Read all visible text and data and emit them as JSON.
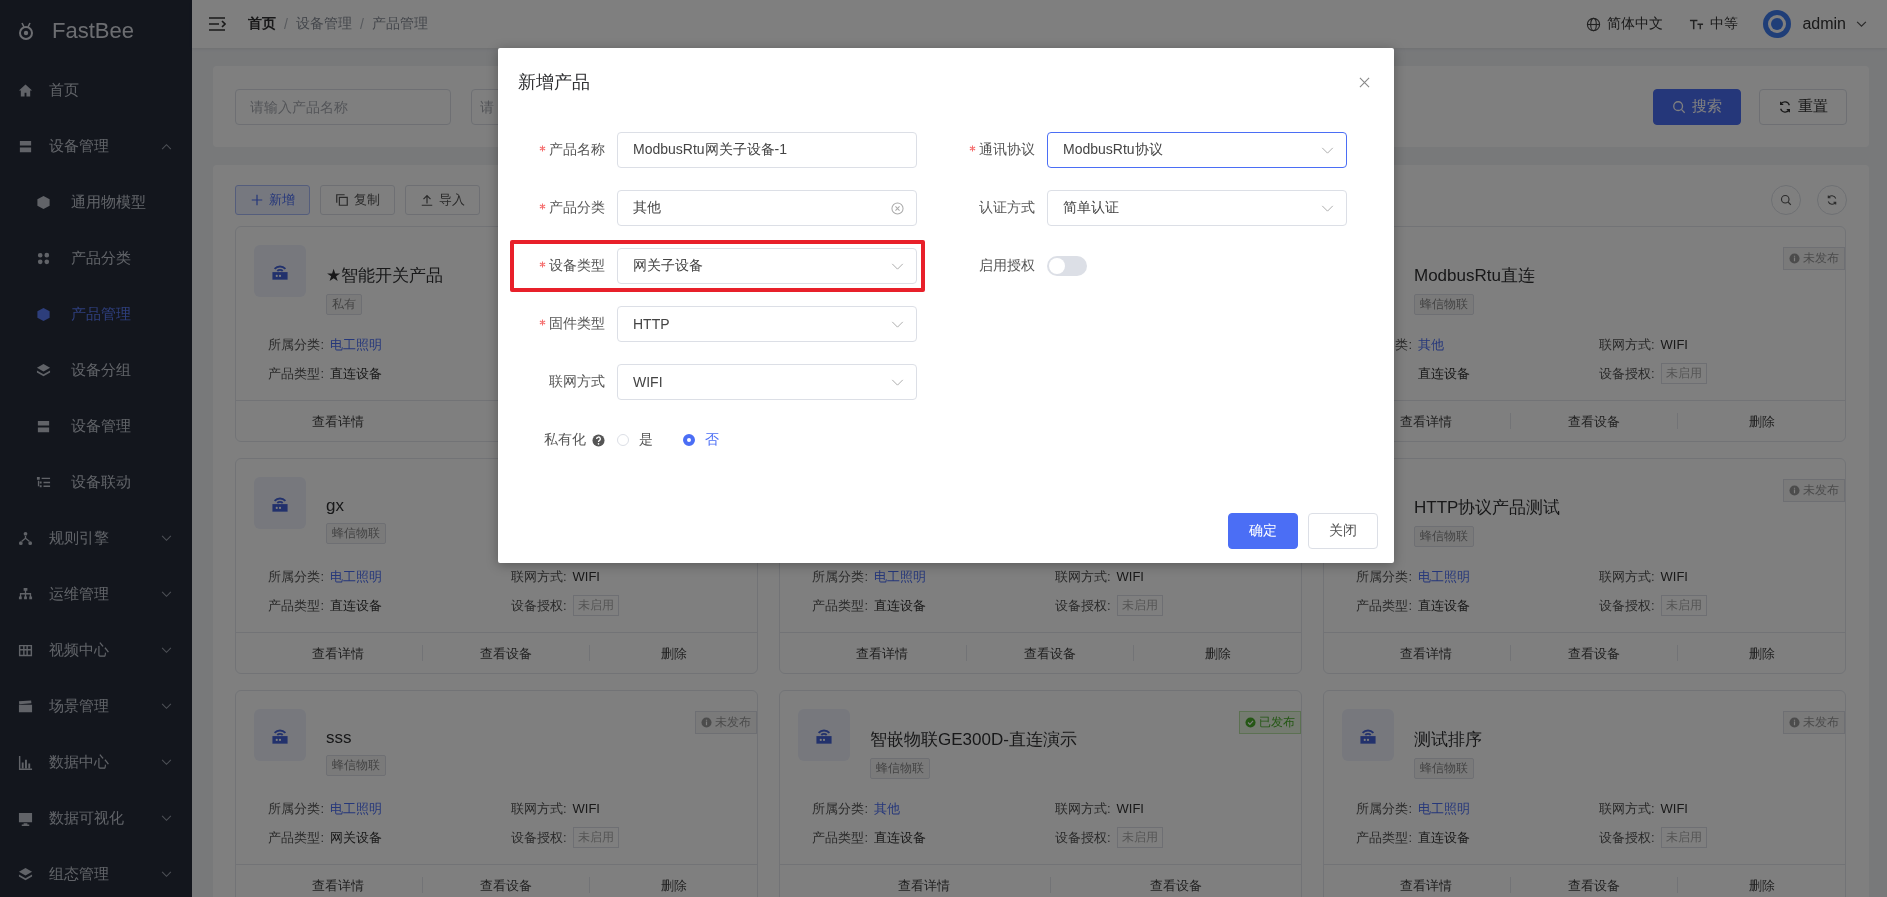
{
  "sidebar": {
    "logo": "FastBee",
    "items": [
      {
        "label": "首页",
        "kind": "link",
        "selected": false
      },
      {
        "label": "设备管理",
        "kind": "group",
        "expanded": true,
        "selected": false,
        "children": [
          {
            "label": "通用物模型",
            "selected": false
          },
          {
            "label": "产品分类",
            "selected": false
          },
          {
            "label": "产品管理",
            "selected": true
          },
          {
            "label": "设备分组",
            "selected": false
          },
          {
            "label": "设备管理",
            "selected": false
          },
          {
            "label": "设备联动",
            "selected": false
          }
        ]
      },
      {
        "label": "规则引擎",
        "kind": "group",
        "expanded": false,
        "selected": false
      },
      {
        "label": "运维管理",
        "kind": "group",
        "expanded": false,
        "selected": false
      },
      {
        "label": "视频中心",
        "kind": "group",
        "expanded": false,
        "selected": false
      },
      {
        "label": "场景管理",
        "kind": "group",
        "expanded": false,
        "selected": false
      },
      {
        "label": "数据中心",
        "kind": "group",
        "expanded": false,
        "selected": false
      },
      {
        "label": "数据可视化",
        "kind": "group",
        "expanded": false,
        "selected": false
      },
      {
        "label": "组态管理",
        "kind": "group",
        "expanded": false,
        "selected": false
      }
    ]
  },
  "topbar": {
    "breadcrumb": {
      "separator": "/",
      "items": [
        "首页",
        "设备管理",
        "产品管理"
      ]
    },
    "language": "简体中文",
    "size": "中等",
    "user": "admin"
  },
  "search": {
    "fields": [
      {
        "placeholder": "请输入产品名称"
      },
      {
        "placeholder": "请"
      }
    ],
    "buttons": [
      {
        "label": "搜索",
        "kind": "primary"
      },
      {
        "label": "重置",
        "kind": "default"
      }
    ]
  },
  "toolbar": {
    "buttons": [
      {
        "label": "新增",
        "kind": "primary"
      },
      {
        "label": "复制",
        "kind": "default"
      },
      {
        "label": "导入",
        "kind": "default"
      }
    ]
  },
  "card_rows": [
    [
      {
        "icon": true,
        "name": "★智能开关产品",
        "tag": "私有",
        "left_fields": [
          {
            "label": "所属分类:",
            "value": "电工照明",
            "kind": "link"
          },
          {
            "label": "产品类型:",
            "value": "直连设备",
            "kind": "text"
          }
        ],
        "actions": [
          "查看详情"
        ]
      },
      {},
      {
        "name": "ModbusRtu直连",
        "tag": "蜂信物联",
        "badge": {
          "text": "未发布",
          "published": false
        },
        "left_fields": [
          {
            "label": "类:",
            "value": "其他",
            "kind": "link"
          },
          {
            "value": "直连设备",
            "kind": "text"
          }
        ],
        "right_fields": [
          {
            "label": "联网方式:",
            "value": "WIFI",
            "kind": "text"
          },
          {
            "label": "设备授权:",
            "value": "未启用",
            "kind": "tag"
          }
        ],
        "actions": [
          "查看详情",
          "查看设备",
          "删除"
        ]
      }
    ],
    [
      {
        "icon": true,
        "name": "gx",
        "tag": "蜂信物联",
        "left_fields": [
          {
            "label": "所属分类:",
            "value": "电工照明",
            "kind": "link"
          },
          {
            "label": "产品类型:",
            "value": "直连设备",
            "kind": "text"
          }
        ],
        "right_fields": [
          {
            "label": "联网方式:",
            "value": "WIFI",
            "kind": "text"
          },
          {
            "label": "设备授权:",
            "value": "未启用",
            "kind": "tag"
          }
        ],
        "actions": [
          "查看详情",
          "查看设备",
          "删除"
        ]
      },
      {
        "left_fields": [
          {
            "label": "所属分类:",
            "value": "电工照明",
            "kind": "link"
          },
          {
            "label": "产品类型:",
            "value": "直连设备",
            "kind": "text"
          }
        ],
        "right_fields": [
          {
            "label": "联网方式:",
            "value": "WIFI",
            "kind": "text"
          },
          {
            "label": "设备授权:",
            "value": "未启用",
            "kind": "tag"
          }
        ],
        "actions": [
          "查看详情",
          "查看设备",
          "删除"
        ]
      },
      {
        "name": "HTTP协议产品测试",
        "tag": "蜂信物联",
        "badge": {
          "text": "未发布",
          "published": false
        },
        "left_fields": [
          {
            "label": "所属分类:",
            "value": "电工照明",
            "kind": "link"
          },
          {
            "label": "产品类型:",
            "value": "直连设备",
            "kind": "text"
          }
        ],
        "right_fields": [
          {
            "label": "联网方式:",
            "value": "WIFI",
            "kind": "text"
          },
          {
            "label": "设备授权:",
            "value": "未启用",
            "kind": "tag"
          }
        ],
        "actions": [
          "查看详情",
          "查看设备",
          "删除"
        ]
      }
    ],
    [
      {
        "icon": true,
        "name": "sss",
        "tag": "蜂信物联",
        "badge": {
          "text": "未发布",
          "published": false
        },
        "left_fields": [
          {
            "label": "所属分类:",
            "value": "电工照明",
            "kind": "link"
          },
          {
            "label": "产品类型:",
            "value": "网关设备",
            "kind": "text"
          }
        ],
        "right_fields": [
          {
            "label": "联网方式:",
            "value": "WIFI",
            "kind": "text"
          },
          {
            "label": "设备授权:",
            "value": "未启用",
            "kind": "tag"
          }
        ],
        "actions": [
          "查看详情",
          "查看设备",
          "删除"
        ]
      },
      {
        "icon": true,
        "name": "智嵌物联GE300D-直连演示",
        "tag": "蜂信物联",
        "badge": {
          "text": "已发布",
          "published": true
        },
        "left_fields": [
          {
            "label": "所属分类:",
            "value": "其他",
            "kind": "link"
          },
          {
            "label": "产品类型:",
            "value": "直连设备",
            "kind": "text"
          }
        ],
        "right_fields": [
          {
            "label": "联网方式:",
            "value": "WIFI",
            "kind": "text"
          },
          {
            "label": "设备授权:",
            "value": "未启用",
            "kind": "tag"
          }
        ],
        "actions": [
          "查看详情",
          "查看设备"
        ]
      },
      {
        "icon": true,
        "name": "测试排序",
        "tag": "蜂信物联",
        "badge": {
          "text": "未发布",
          "published": false
        },
        "left_fields": [
          {
            "label": "所属分类:",
            "value": "电工照明",
            "kind": "link"
          },
          {
            "label": "产品类型:",
            "value": "直连设备",
            "kind": "text"
          }
        ],
        "right_fields": [
          {
            "label": "联网方式:",
            "value": "WIFI",
            "kind": "text"
          },
          {
            "label": "设备授权:",
            "value": "未启用",
            "kind": "tag"
          }
        ],
        "actions": [
          "查看详情",
          "查看设备",
          "删除"
        ]
      }
    ]
  ],
  "dialog": {
    "title": "新增产品",
    "left_fields": [
      {
        "label": "产品名称",
        "required": true,
        "kind": "input",
        "value": "ModbusRtu网关子设备-1",
        "clearable": false,
        "focused": false,
        "highlighted": false
      },
      {
        "label": "产品分类",
        "required": true,
        "kind": "input",
        "value": "其他",
        "clearable": true,
        "focused": false,
        "highlighted": false
      },
      {
        "label": "设备类型",
        "required": true,
        "kind": "select",
        "value": "网关子设备",
        "focused": false,
        "highlighted": true
      },
      {
        "label": "固件类型",
        "required": true,
        "kind": "select",
        "value": "HTTP",
        "focused": false,
        "highlighted": false
      },
      {
        "label": "联网方式",
        "required": false,
        "kind": "select",
        "value": "WIFI",
        "focused": false,
        "highlighted": false
      },
      {
        "label": "私有化",
        "required": false,
        "kind": "radio",
        "help": true,
        "options": [
          {
            "label": "是",
            "selected": false
          },
          {
            "label": "否",
            "selected": true
          }
        ]
      }
    ],
    "right_fields": [
      {
        "label": "通讯协议",
        "required": true,
        "kind": "select",
        "value": "ModbusRtu协议",
        "focused": true,
        "highlighted": false
      },
      {
        "label": "认证方式",
        "required": false,
        "kind": "select",
        "value": "简单认证",
        "focused": false,
        "highlighted": false
      },
      {
        "label": "启用授权",
        "required": false,
        "kind": "switch",
        "on": false
      }
    ],
    "buttons": [
      {
        "label": "确定",
        "kind": "primary"
      },
      {
        "label": "关闭",
        "kind": "default"
      }
    ]
  }
}
